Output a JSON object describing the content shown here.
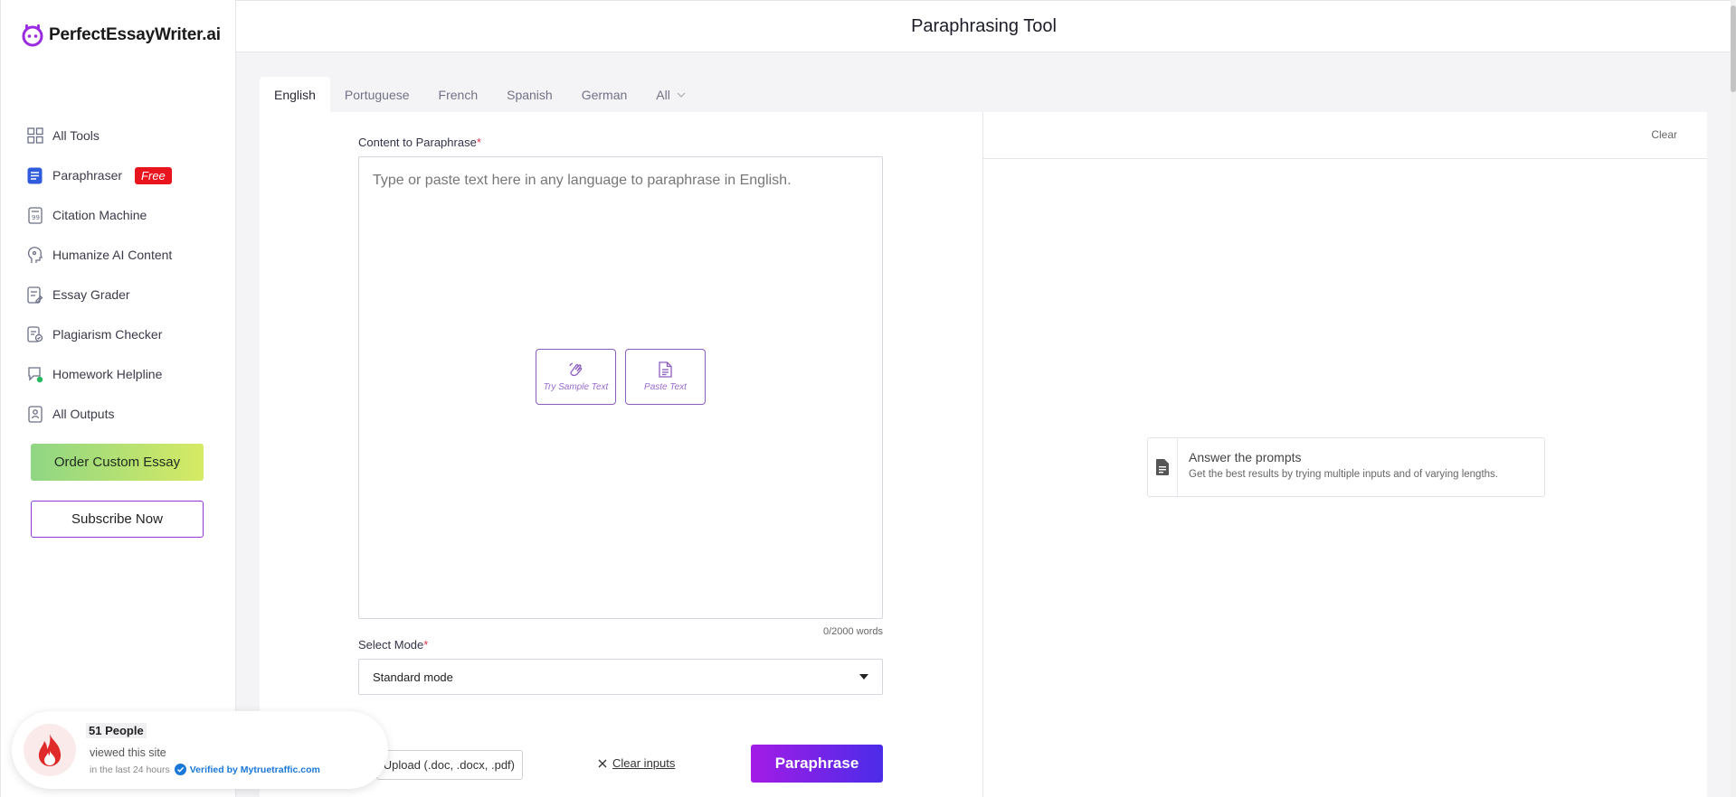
{
  "logo": {
    "text": "PerfectEssayWriter.ai"
  },
  "header": {
    "title": "Paraphrasing Tool"
  },
  "sidebar": {
    "items": [
      {
        "label": "All Tools",
        "icon": "grid-icon"
      },
      {
        "label": "Paraphraser",
        "icon": "document-icon",
        "badge": "Free"
      },
      {
        "label": "Citation Machine",
        "icon": "citation-icon"
      },
      {
        "label": "Humanize AI Content",
        "icon": "humanize-icon"
      },
      {
        "label": "Essay Grader",
        "icon": "grader-icon"
      },
      {
        "label": "Plagiarism Checker",
        "icon": "plagiarism-icon"
      },
      {
        "label": "Homework Helpline",
        "icon": "chat-icon"
      },
      {
        "label": "All Outputs",
        "icon": "outputs-icon"
      }
    ],
    "order_label": "Order Custom Essay",
    "subscribe_label": "Subscribe Now"
  },
  "tabs": [
    {
      "label": "English",
      "active": true
    },
    {
      "label": "Portuguese"
    },
    {
      "label": "French"
    },
    {
      "label": "Spanish"
    },
    {
      "label": "German"
    },
    {
      "label": "All"
    }
  ],
  "editor": {
    "content_label": "Content to Paraphrase",
    "required_mark": "*",
    "placeholder": "Type or paste text here in any language to paraphrase in English.",
    "sample_label": "Try Sample Text",
    "paste_label": "Paste Text",
    "word_count": "0/2000 words",
    "mode_label": "Select Mode",
    "mode_value": "Standard mode",
    "upload_label": "Upload (.doc, .docx, .pdf)",
    "clear_inputs_label": "Clear inputs",
    "paraphrase_label": "Paraphrase"
  },
  "output": {
    "clear_label": "Clear",
    "prompt_title": "Answer the prompts",
    "prompt_sub": "Get the best results by trying multiple inputs and of varying lengths."
  },
  "proof": {
    "count": "51 People",
    "line2": "viewed this site",
    "line3": "in the last 24 hours",
    "verified": "Verified by Mytruetraffic.com"
  },
  "colors": {
    "accent": "#8e3bd6",
    "badge": "#e8141e",
    "paraphrase_start": "#a31be6",
    "paraphrase_end": "#4b2ce8"
  }
}
